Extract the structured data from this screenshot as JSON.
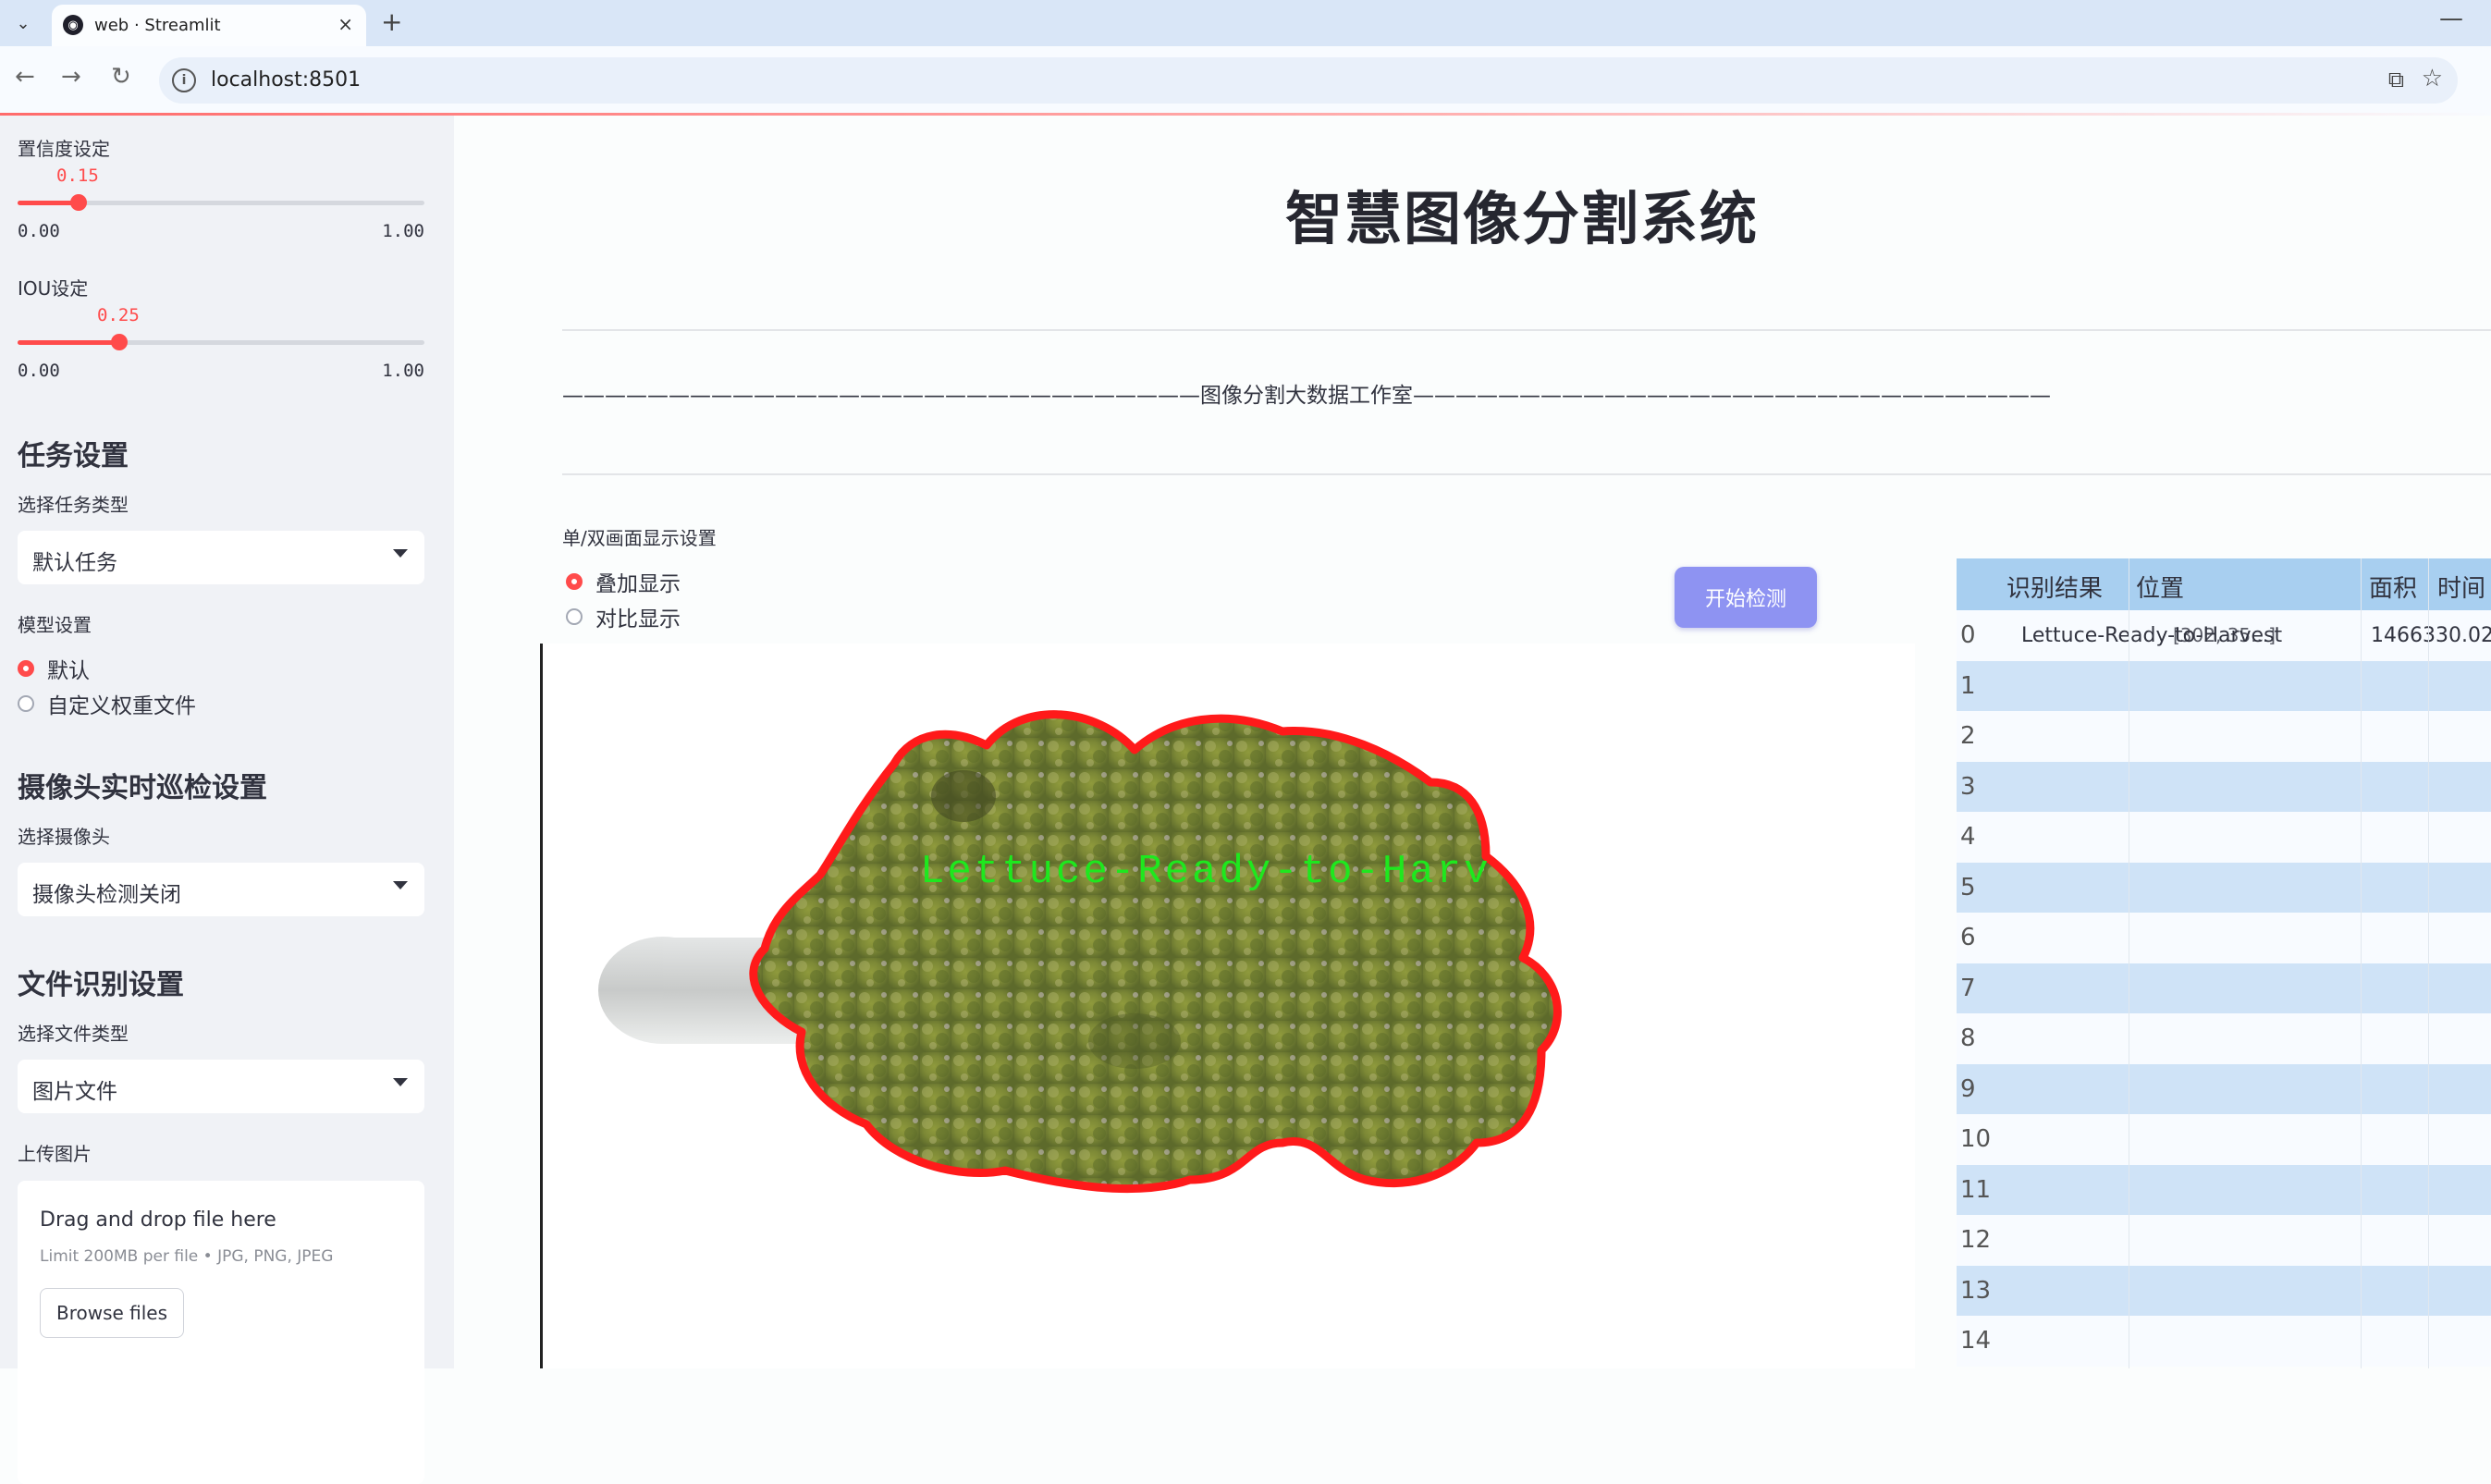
{
  "browser": {
    "tab_title": "web · Streamlit",
    "url": "localhost:8501",
    "new_tab": "+",
    "close": "×",
    "minimize": "—"
  },
  "sidebar": {
    "confidence": {
      "label": "置信度设定",
      "value": "0.15",
      "value_fraction": 0.15,
      "min": "0.00",
      "max": "1.00"
    },
    "iou": {
      "label": "IOU设定",
      "value": "0.25",
      "value_fraction": 0.25,
      "min": "0.00",
      "max": "1.00"
    },
    "task_heading": "任务设置",
    "task_type_label": "选择任务类型",
    "task_type_value": "默认任务",
    "model_label": "模型设置",
    "model_options": [
      "默认",
      "自定义权重文件"
    ],
    "model_selected": 0,
    "camera_heading": "摄像头实时巡检设置",
    "camera_label": "选择摄像头",
    "camera_value": "摄像头检测关闭",
    "file_heading": "文件识别设置",
    "file_type_label": "选择文件类型",
    "file_type_value": "图片文件",
    "upload_label": "上传图片",
    "dropzone_title": "Drag and drop file here",
    "dropzone_sub": "Limit 200MB per file • JPG, PNG, JPEG",
    "browse_button": "Browse files"
  },
  "main": {
    "title": "智慧图像分割系统",
    "banner": "——————————————————————————————图像分割大数据工作室——————————————————————————————",
    "display_label": "单/双画面显示设置",
    "display_options": [
      "叠加显示",
      "对比显示"
    ],
    "display_selected": 0,
    "start_button": "开始检测",
    "detection_label": "Lettuce-Ready-to-Harv"
  },
  "table": {
    "columns": [
      "识别结果",
      "位置",
      "面积",
      "时间"
    ],
    "row_indices": [
      "0",
      "1",
      "2",
      "3",
      "4",
      "5",
      "6",
      "7",
      "8",
      "9",
      "10",
      "11",
      "12",
      "13",
      "14"
    ],
    "rows": [
      {
        "result": "Lettuce-Ready-to-Harvest",
        "position": "[302, 35...]",
        "area": "1466330.02"
      }
    ]
  },
  "colors": {
    "accent": "#ff4b4b",
    "sidebar_bg": "#f0f2f6",
    "button": "#8e93f2",
    "table_header": "#a8cff0",
    "table_alt": "#cfe3f7",
    "mask_outline": "#ff1a1a",
    "label_green": "#1ee81e"
  }
}
